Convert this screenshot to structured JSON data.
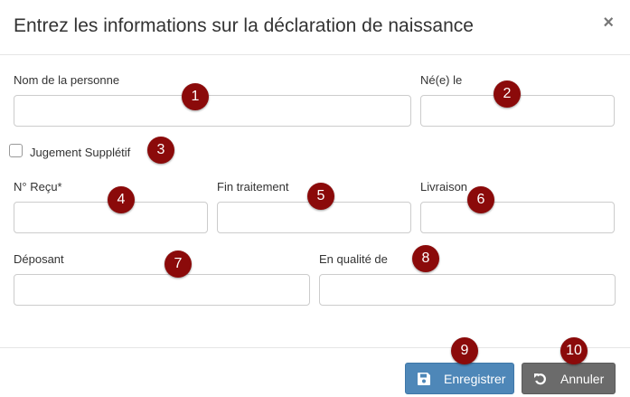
{
  "dialog": {
    "title": "Entrez les informations sur la déclaration de naissance",
    "close_glyph": "×"
  },
  "fields": {
    "nom_label": "Nom de la personne",
    "nom_value": "",
    "nee_label": "Né(e) le",
    "nee_value": "",
    "jugement_label": "Jugement Supplétif",
    "jugement_checked": false,
    "recu_label": "N° Reçu*",
    "recu_value": "",
    "fin_label": "Fin traitement",
    "fin_value": "",
    "livraison_label": "Livraison",
    "livraison_value": "",
    "deposant_label": "Déposant",
    "deposant_value": "",
    "qualite_label": "En qualité de",
    "qualite_value": ""
  },
  "annotations": [
    "1",
    "2",
    "3",
    "4",
    "5",
    "6",
    "7",
    "8",
    "9",
    "10"
  ],
  "buttons": {
    "save_label": "Enregistrer",
    "save_icon": "floppy-disk-icon",
    "cancel_label": "Annuler",
    "cancel_icon": "undo-icon"
  },
  "colors": {
    "save_button": "#4e87b8",
    "cancel_button": "#6b6b6b",
    "annotation_badge": "#8b0a0a"
  }
}
